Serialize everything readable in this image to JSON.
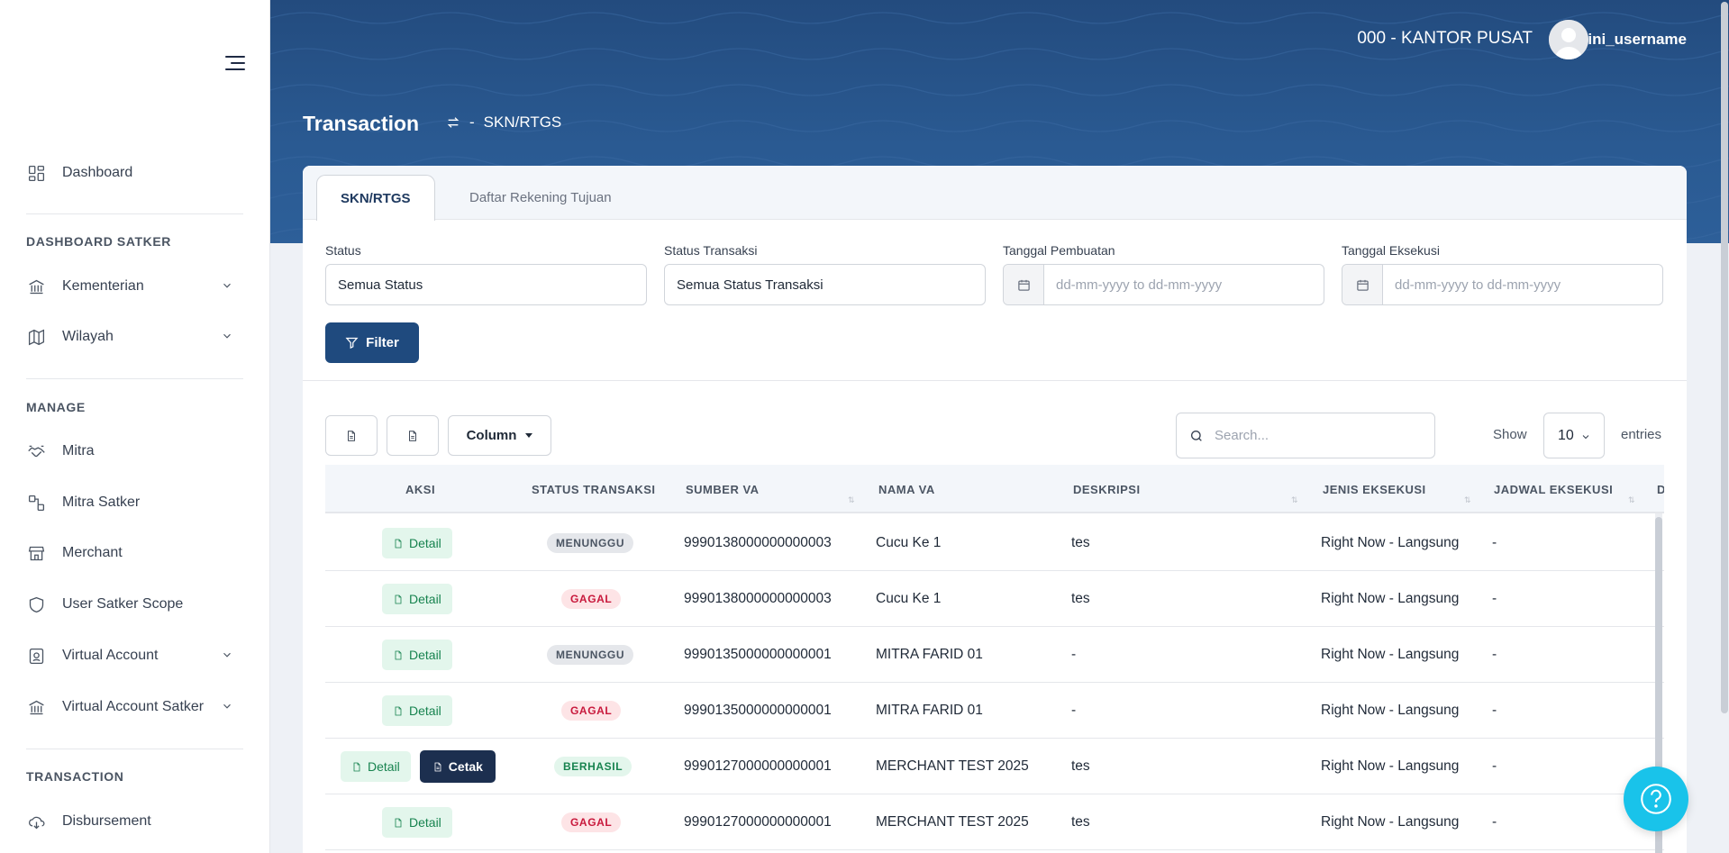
{
  "sidebar": {
    "dashboard": "Dashboard",
    "section_satker": "DASHBOARD SATKER",
    "kementerian": "Kementerian",
    "wilayah": "Wilayah",
    "section_manage": "MANAGE",
    "mitra": "Mitra",
    "mitra_satker": "Mitra Satker",
    "merchant": "Merchant",
    "user_satker_scope": "User Satker Scope",
    "virtual_account": "Virtual Account",
    "virtual_account_satker": "Virtual Account Satker",
    "section_transaction": "TRANSACTION",
    "disbursement": "Disbursement"
  },
  "header": {
    "org": "000 - KANTOR PUSAT",
    "username": "ini_username",
    "title": "Transaction",
    "crumb_sep": "-",
    "crumb": "SKN/RTGS"
  },
  "tabs": [
    "SKN/RTGS",
    "Daftar Rekening Tujuan"
  ],
  "filters": {
    "status_label": "Status",
    "status_value": "Semua Status",
    "status_transaksi_label": "Status Transaksi",
    "status_transaksi_value": "Semua Status Transaksi",
    "tgl_pembuatan_label": "Tanggal Pembuatan",
    "tgl_eksekusi_label": "Tanggal Eksekusi",
    "date_placeholder": "dd-mm-yyyy to dd-mm-yyyy",
    "filter_button": "Filter"
  },
  "toolbar": {
    "column_button": "Column",
    "search_placeholder": "Search...",
    "show_label": "Show",
    "page_size": "10",
    "entries_label": "entries"
  },
  "table": {
    "headers": [
      "AKSI",
      "STATUS TRANSAKSI",
      "SUMBER VA",
      "NAMA VA",
      "DESKRIPSI",
      "JENIS EKSEKUSI",
      "JADWAL EKSEKUSI",
      "D"
    ],
    "detail_label": "Detail",
    "cetak_label": "Cetak",
    "rows": [
      {
        "status": "MENUNGGU",
        "sumber": "9990138000000000003",
        "nama": "Cucu Ke 1",
        "deskripsi": "tes",
        "jenis": "Right Now - Langsung",
        "jadwal": "-"
      },
      {
        "status": "GAGAL",
        "sumber": "9990138000000000003",
        "nama": "Cucu Ke 1",
        "deskripsi": "tes",
        "jenis": "Right Now - Langsung",
        "jadwal": "-"
      },
      {
        "status": "MENUNGGU",
        "sumber": "9990135000000000001",
        "nama": "MITRA FARID 01",
        "deskripsi": "-",
        "jenis": "Right Now - Langsung",
        "jadwal": "-"
      },
      {
        "status": "GAGAL",
        "sumber": "9990135000000000001",
        "nama": "MITRA FARID 01",
        "deskripsi": "-",
        "jenis": "Right Now - Langsung",
        "jadwal": "-"
      },
      {
        "status": "BERHASIL",
        "sumber": "9990127000000000001",
        "nama": "MERCHANT TEST 2025",
        "deskripsi": "tes",
        "jenis": "Right Now - Langsung",
        "jadwal": "-"
      },
      {
        "status": "GAGAL",
        "sumber": "9990127000000000001",
        "nama": "MERCHANT TEST 2025",
        "deskripsi": "tes",
        "jenis": "Right Now - Langsung",
        "jadwal": "-"
      }
    ]
  },
  "colors": {
    "banner": "#234b7e",
    "primary": "#1f4a7e",
    "success": "#17834f",
    "danger": "#c8193c",
    "help": "#19c3ea"
  }
}
